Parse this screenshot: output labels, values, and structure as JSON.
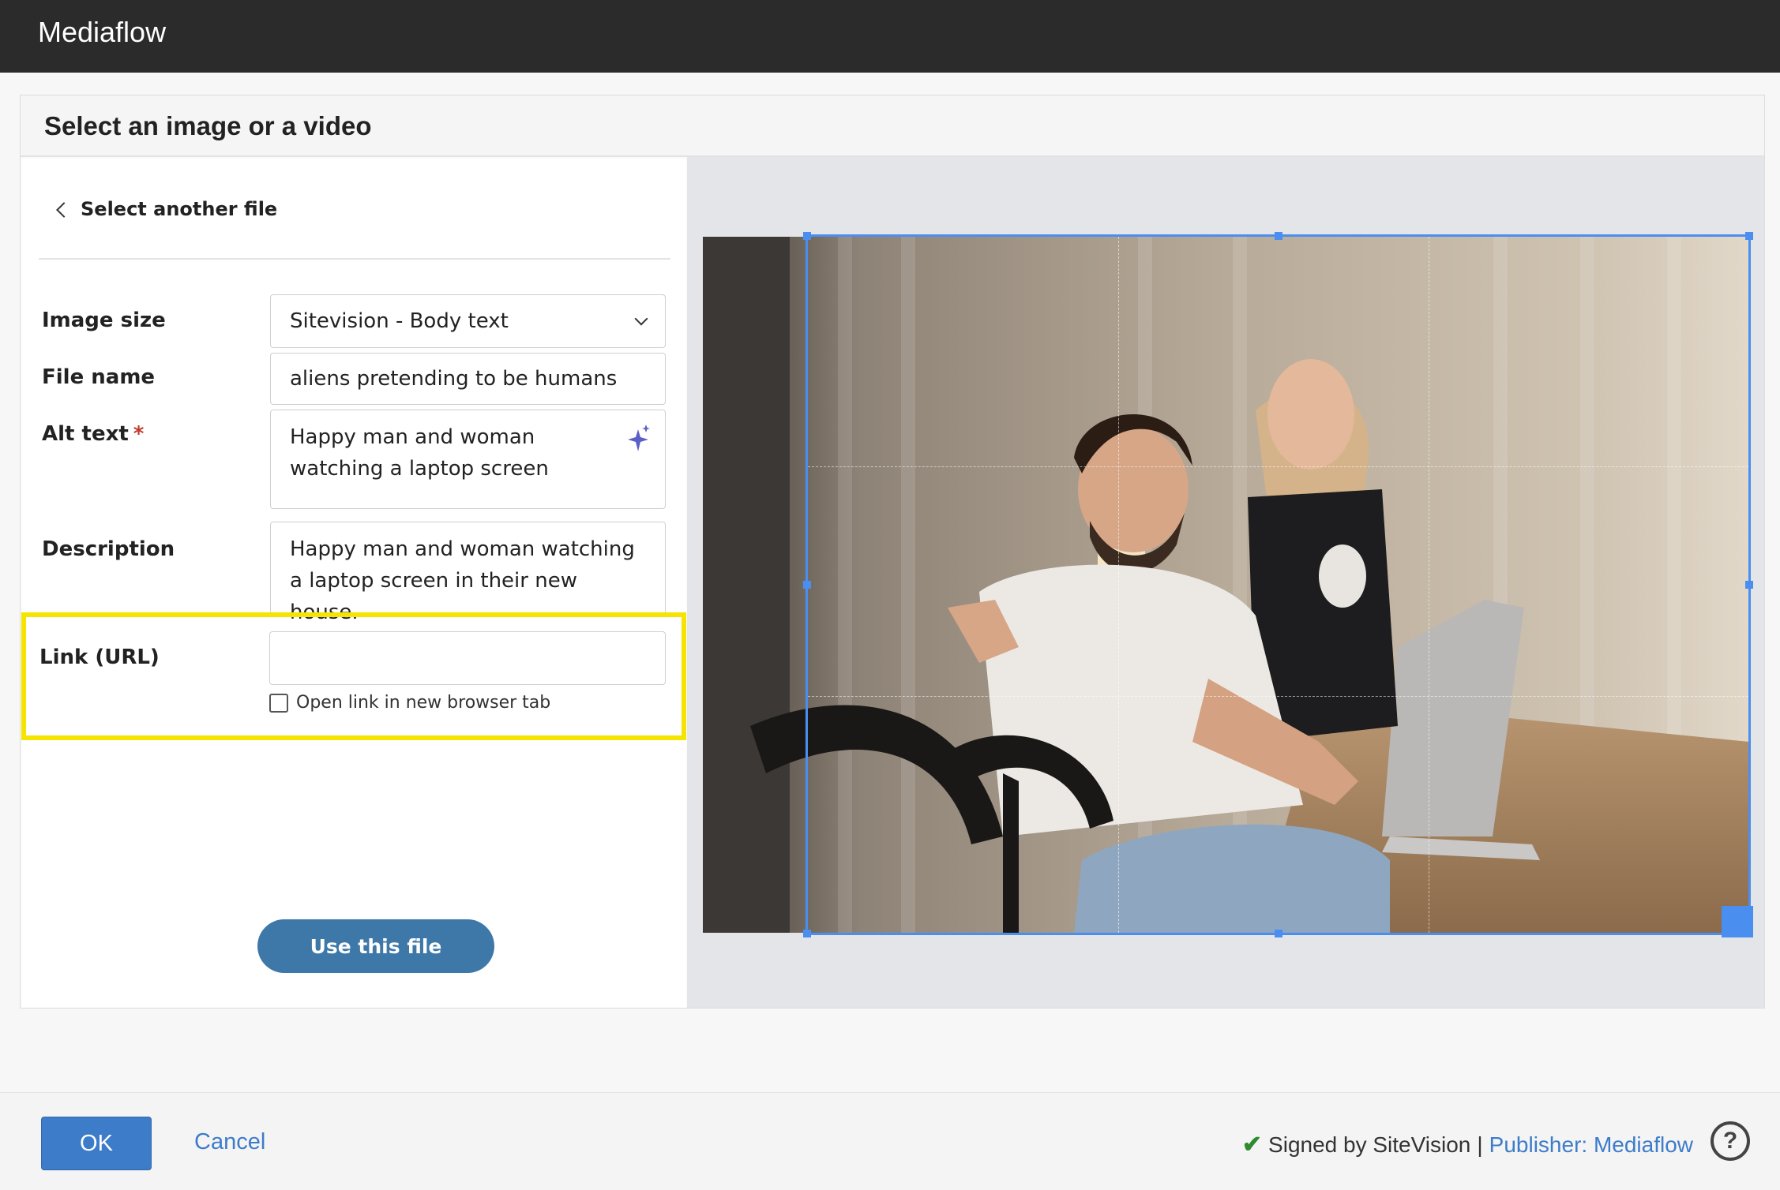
{
  "app": {
    "title": "Mediaflow"
  },
  "dialog": {
    "title": "Select an image or a video"
  },
  "form": {
    "back_label": "Select another file",
    "image_size": {
      "label": "Image size",
      "value": "Sitevision - Body text"
    },
    "file_name": {
      "label": "File name",
      "value": "aliens pretending to be humans"
    },
    "alt_text": {
      "label": "Alt text",
      "required_mark": "*",
      "value": "Happy man and woman watching a laptop screen"
    },
    "description": {
      "label": "Description",
      "value": "Happy man and woman watching a laptop screen in their new house."
    },
    "link": {
      "label": "Link (URL)",
      "value": "",
      "checkbox_label": "Open link in new browser tab",
      "checked": false
    },
    "use_button": "Use this file"
  },
  "footer": {
    "ok_label": "OK",
    "cancel_label": "Cancel",
    "signed_label": "Signed by SiteVision",
    "separator": "|",
    "publisher_label": "Publisher: Mediaflow",
    "help_label": "?"
  },
  "colors": {
    "highlight": "#f5e400",
    "primary_button": "#3d78a8",
    "link": "#3d7cc9",
    "crop_frame": "#4a8ef0"
  },
  "icons": [
    "chevron-left-icon",
    "chevron-down-icon",
    "sparkle-icon",
    "check-icon",
    "help-icon"
  ]
}
